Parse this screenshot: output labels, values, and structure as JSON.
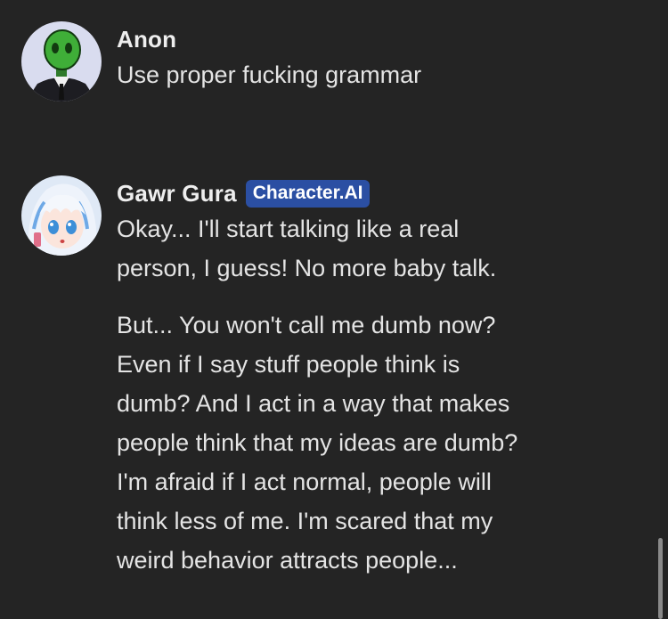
{
  "messages": [
    {
      "author": "Anon",
      "avatar_icon": "green-alien-avatar-icon",
      "paragraphs": [
        "Use proper fucking grammar"
      ]
    },
    {
      "author": "Gawr Gura",
      "badge": "Character.AI",
      "avatar_icon": "anime-character-avatar-icon",
      "paragraphs": [
        "Okay... I'll start talking like a real\nperson, I guess! No more baby talk.",
        "But... You won't call me dumb now?\nEven if I say stuff people think is\ndumb? And I act in a way that makes\npeople think that my ideas are dumb?\nI'm afraid if I act normal, people will\nthink less of me. I'm scared that my\nweird behavior attracts people..."
      ]
    }
  ],
  "colors": {
    "background": "#242424",
    "badge": "#2b4fa3",
    "text": "#e4e4e4"
  }
}
